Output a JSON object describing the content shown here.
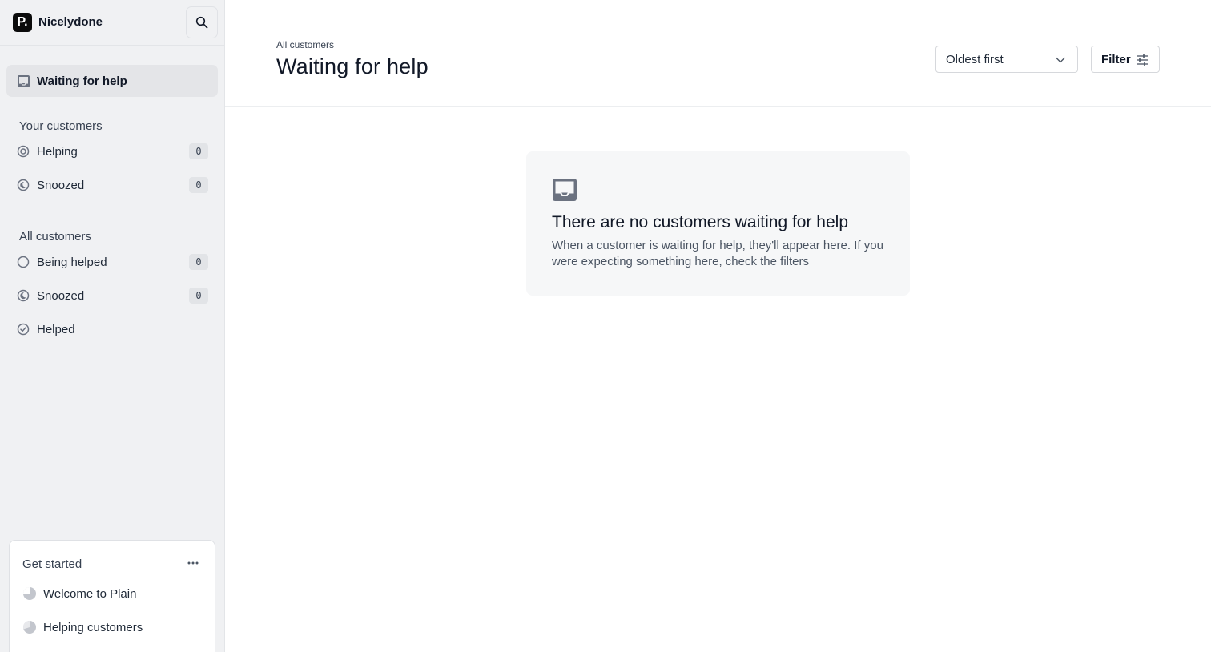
{
  "sidebar": {
    "logo_letter": "P.",
    "workspace_name": "Nicelydone",
    "active_item": {
      "label": "Waiting for help",
      "icon": "inbox-icon"
    },
    "your_customers": {
      "title": "Your customers",
      "items": [
        {
          "label": "Helping",
          "count": "0",
          "icon": "target-icon"
        },
        {
          "label": "Snoozed",
          "count": "0",
          "icon": "snooze-icon"
        }
      ]
    },
    "all_customers": {
      "title": "All customers",
      "items": [
        {
          "label": "Being helped",
          "count": "0",
          "icon": "circle-icon"
        },
        {
          "label": "Snoozed",
          "count": "0",
          "icon": "snooze-icon"
        },
        {
          "label": "Helped",
          "icon": "check-circle-icon"
        }
      ]
    },
    "get_started": {
      "title": "Get started",
      "items": [
        {
          "label": "Welcome to Plain",
          "icon": "progress-pie-icon"
        },
        {
          "label": "Helping customers",
          "icon": "progress-pie-icon"
        }
      ]
    }
  },
  "main": {
    "breadcrumb": "All customers",
    "title": "Waiting for help",
    "sort": {
      "selected": "Oldest first"
    },
    "filter_label": "Filter",
    "empty_state": {
      "title": "There are no customers waiting for help",
      "text": "When a customer is waiting for help, they'll appear here. If you were expecting something here, check the filters"
    }
  },
  "colors": {
    "sidebar_bg": "#f0f1f3",
    "active_bg": "#e4e5e8",
    "icon_gray": "#6b7280",
    "card_bg": "#f6f7f8"
  }
}
